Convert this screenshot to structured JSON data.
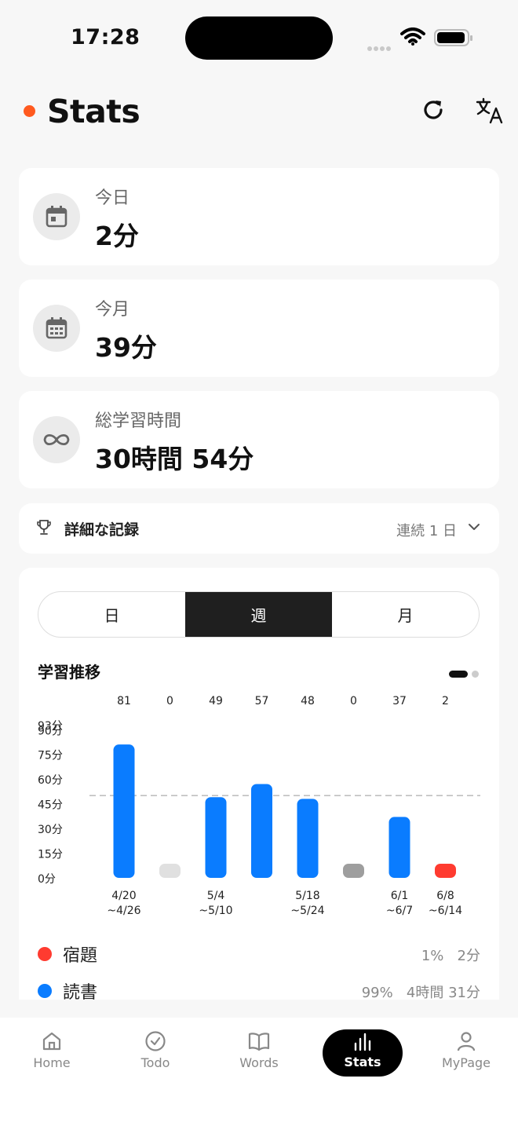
{
  "status": {
    "time": "17:28"
  },
  "header": {
    "title": "Stats"
  },
  "stats": [
    {
      "label": "今日",
      "value": "2分",
      "icon": "calendar-day-icon"
    },
    {
      "label": "今月",
      "value": "39分",
      "icon": "calendar-month-icon"
    },
    {
      "label": "総学習時間",
      "value": "30時間 54分",
      "icon": "infinity-icon"
    }
  ],
  "record": {
    "label": "詳細な記録",
    "streak": "連続 1 日"
  },
  "segment": {
    "tabs": [
      "日",
      "週",
      "月"
    ],
    "active": 1
  },
  "chart": {
    "title": "学習推移"
  },
  "chart_data": {
    "type": "bar",
    "categories": [
      "4/20\n~4/26",
      "",
      "5/4\n~5/10",
      "",
      "5/18\n~5/24",
      "",
      "6/1\n~6/7",
      "6/8\n~6/14"
    ],
    "values": [
      81,
      0,
      49,
      57,
      48,
      0,
      37,
      2
    ],
    "value_labels": [
      "81",
      "0",
      "49",
      "57",
      "48",
      "0",
      "37",
      "2"
    ],
    "y_ticks": [
      "0分",
      "15分",
      "30分",
      "45分",
      "60分",
      "75分",
      "90分",
      "93分"
    ],
    "ylim": [
      0,
      93
    ],
    "reference_line": 50,
    "colors": {
      "bar": "#0a7cff",
      "partial": "#ff3b30",
      "empty": "#e0e0e0",
      "empty_dark": "#9e9e9e"
    }
  },
  "legend": [
    {
      "name": "宿題",
      "percent": "1%",
      "time": "2分",
      "color": "#ff3b30"
    },
    {
      "name": "読書",
      "percent": "99%",
      "time": "4時間 31分",
      "color": "#0a7cff"
    }
  ],
  "tabs": [
    {
      "label": "Home",
      "icon": "home-icon"
    },
    {
      "label": "Todo",
      "icon": "check-circle-icon"
    },
    {
      "label": "Words",
      "icon": "book-icon"
    },
    {
      "label": "Stats",
      "icon": "bar-chart-icon"
    },
    {
      "label": "MyPage",
      "icon": "person-icon"
    }
  ]
}
